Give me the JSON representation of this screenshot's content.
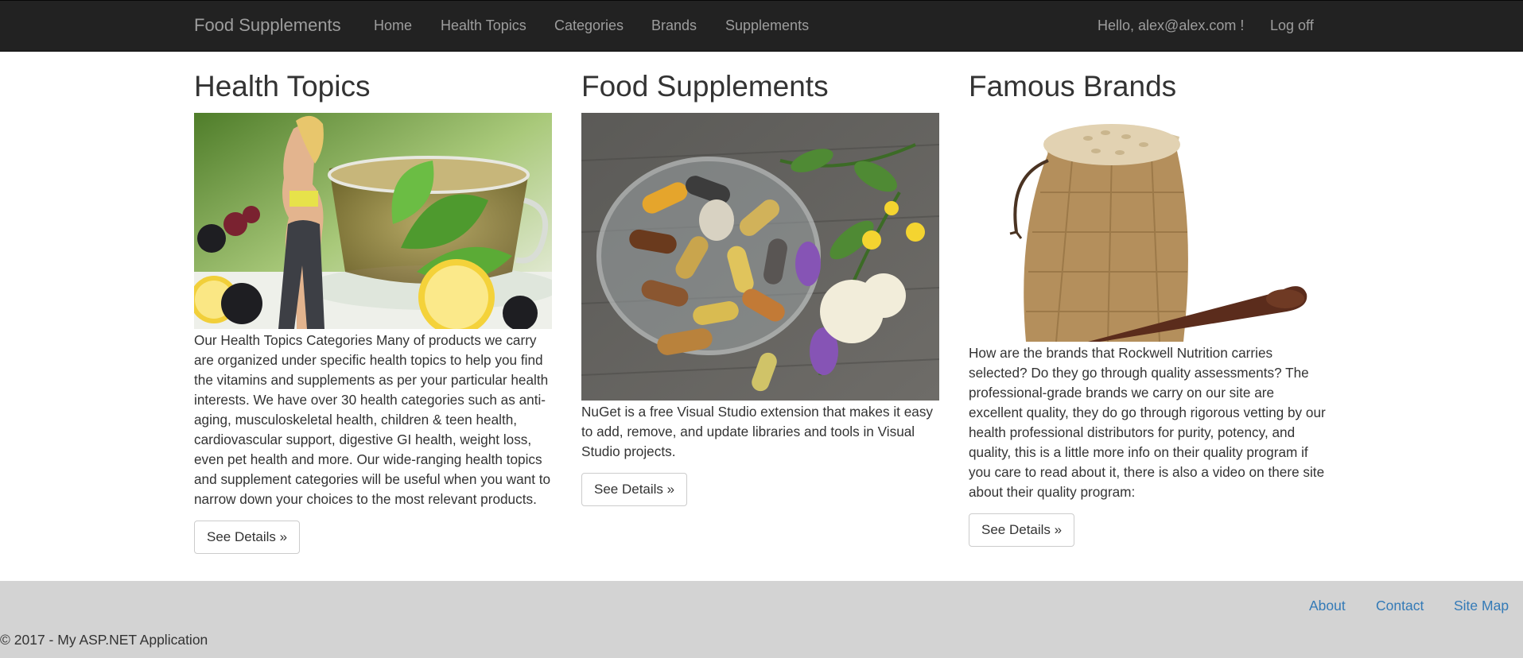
{
  "navbar": {
    "brand": "Food Supplements",
    "links": [
      "Home",
      "Health Topics",
      "Categories",
      "Brands",
      "Supplements"
    ],
    "greeting": "Hello, alex@alex.com !",
    "logoff": "Log off"
  },
  "columns": [
    {
      "title": "Health Topics",
      "image": "tea-mint-lemon-berries-woman-icon",
      "text": "Our Health Topics Categories Many of products we carry are organized under specific health topics to help you find the vitamins and supplements as per your particular health interests. We have over 30 health categories such as anti-aging, musculoskeletal health, children & teen health, cardiovascular support, digestive GI health, weight loss, even pet health and more. Our wide-ranging health topics and supplement categories will be useful when you want to narrow down your choices to the most relevant products.",
      "button": "See Details »"
    },
    {
      "title": "Food Supplements",
      "image": "pills-bowl-herbs-icon",
      "text": "NuGet is a free Visual Studio extension that makes it easy to add, remove, and update libraries and tools in Visual Studio projects.",
      "button": "See Details »"
    },
    {
      "title": "Famous Brands",
      "image": "grain-sack-wooden-spoon-icon",
      "text": "How are the brands that Rockwell Nutrition carries selected? Do they go through quality assessments? The professional-grade brands we carry on our site are excellent quality, they do go through rigorous vetting by our health professional distributors for purity, potency, and quality, this is a little more info on their quality program if you care to read about it, there is also a video on there site about their quality program:",
      "button": "See Details »"
    }
  ],
  "footer": {
    "links": [
      "About",
      "Contact",
      "Site Map"
    ],
    "copyright": "© 2017 - My ASP.NET Application"
  },
  "colors": {
    "navbar_bg": "#222222",
    "nav_text": "#9d9d9d",
    "footer_bg": "#d3d3d3",
    "link": "#337ab7"
  }
}
